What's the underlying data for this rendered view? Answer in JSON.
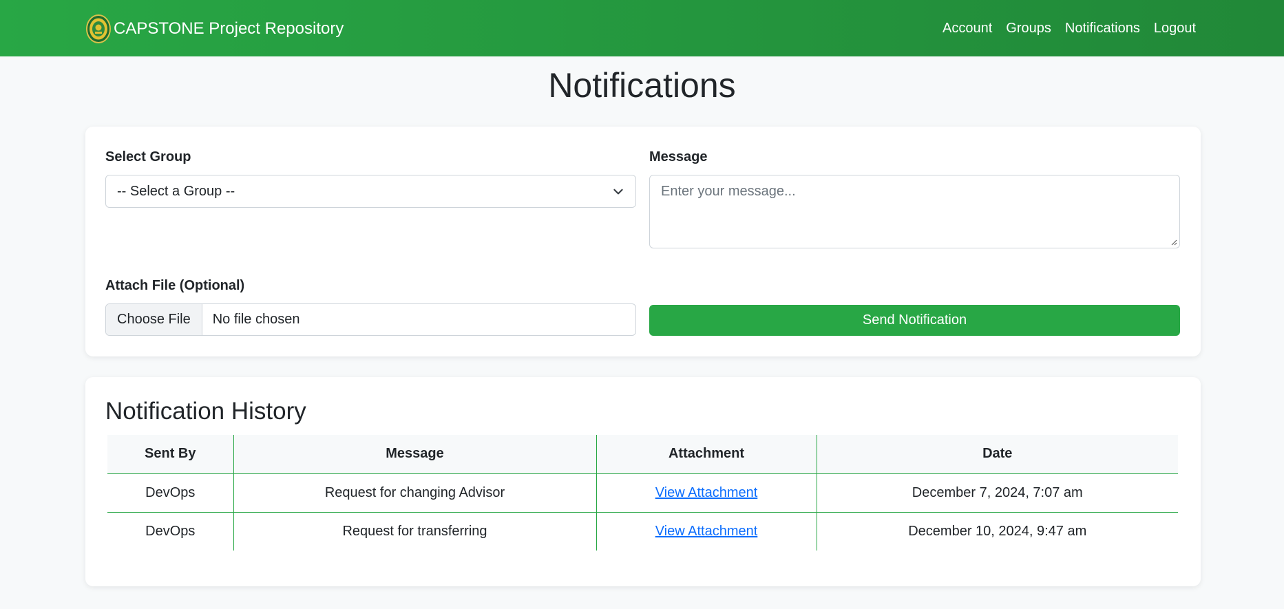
{
  "navbar": {
    "brand": "CAPSTONE Project Repository",
    "links": [
      "Account",
      "Groups",
      "Notifications",
      "Logout"
    ]
  },
  "page": {
    "title": "Notifications"
  },
  "form": {
    "group_label": "Select Group",
    "group_selected": "-- Select a Group --",
    "message_label": "Message",
    "message_placeholder": "Enter your message...",
    "attach_label": "Attach File (Optional)",
    "choose_file": "Choose File",
    "no_file": "No file chosen",
    "send_label": "Send Notification"
  },
  "history": {
    "title": "Notification History",
    "columns": [
      "Sent By",
      "Message",
      "Attachment",
      "Date"
    ],
    "rows": [
      [
        "DevOps",
        "Request for changing Advisor",
        "View Attachment",
        "December 7, 2024, 7:07 am"
      ],
      [
        "DevOps",
        "Request for transferring",
        "View Attachment",
        "December 10, 2024, 9:47 am"
      ]
    ]
  },
  "colors": {
    "accent": "#28a745",
    "link": "#0d6efd",
    "background": "#f7f9fa"
  },
  "icons": {
    "logo": "seal-logo-icon",
    "select": "chevron-down-icon"
  }
}
